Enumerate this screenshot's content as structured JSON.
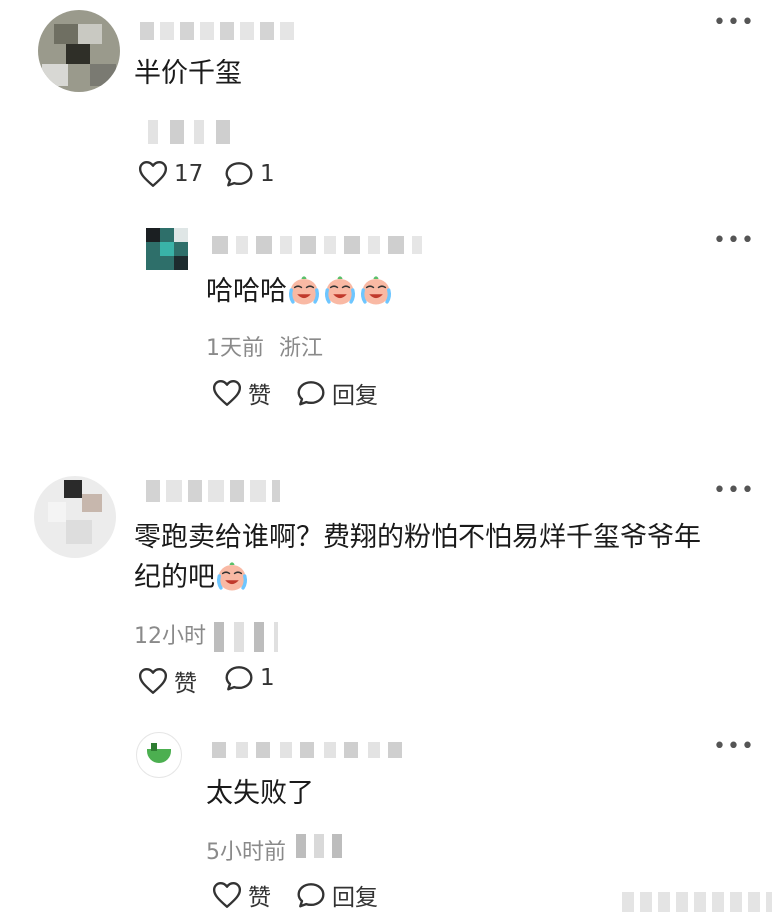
{
  "comments": [
    {
      "text": "半价千玺",
      "likes": "17",
      "replies": "1"
    },
    {
      "text": "哈哈哈",
      "time": "1天前",
      "location": "浙江",
      "like_label": "赞",
      "reply_label": "回复"
    },
    {
      "line1": "零跑卖给谁啊？费翔的粉怕不怕易烊千玺爷爷年",
      "line2": "纪的吧",
      "time": "12小时",
      "like_label": "赞",
      "replies": "1"
    },
    {
      "text": "太失败了",
      "time": "5小时前",
      "like_label": "赞",
      "reply_label": "回复"
    }
  ],
  "icons": {
    "more": "more-dots-icon",
    "like": "heart-icon",
    "reply": "comment-bubble-icon",
    "emoji": "laughing-crying-emoji"
  },
  "colors": {
    "text": "#1a1a1a",
    "meta": "#8a8a8a",
    "icon": "#333333"
  }
}
